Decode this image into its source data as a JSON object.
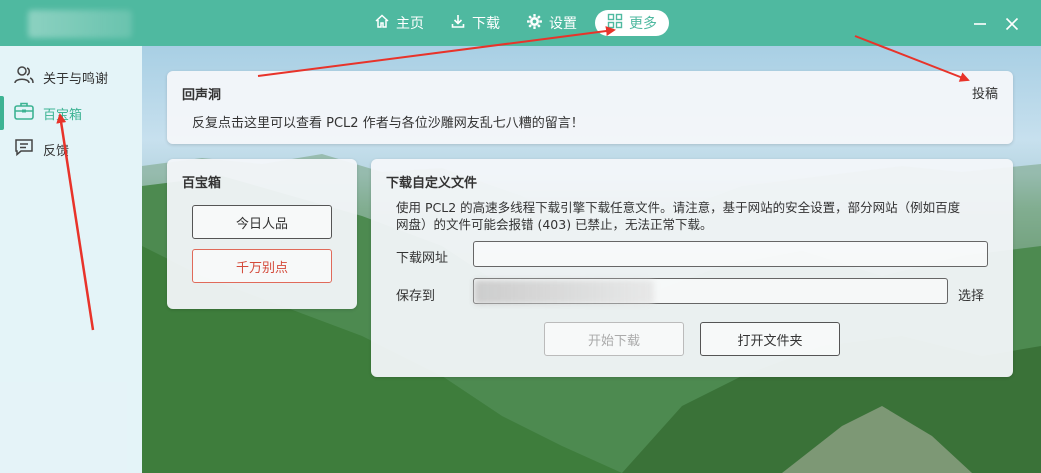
{
  "nav": {
    "items": [
      {
        "label": "主页",
        "icon": "home-icon"
      },
      {
        "label": "下载",
        "icon": "download-icon"
      },
      {
        "label": "设置",
        "icon": "gear-icon"
      },
      {
        "label": "更多",
        "icon": "grid-icon",
        "active": true
      }
    ],
    "minimize": "—",
    "close": "✕"
  },
  "sidebar": {
    "items": [
      {
        "label": "关于与鸣谢",
        "icon": "user-icon"
      },
      {
        "label": "百宝箱",
        "icon": "toolbox-icon",
        "active": true
      },
      {
        "label": "反馈",
        "icon": "chat-icon"
      }
    ]
  },
  "echo_card": {
    "title": "回声洞",
    "submit": "投稿",
    "text": "反复点击这里可以查看 PCL2 作者与各位沙雕网友乱七八糟的留言！"
  },
  "toolbox_card": {
    "title": "百宝箱",
    "btn_luck": "今日人品",
    "btn_noclick": "千万别点"
  },
  "download_card": {
    "title": "下载自定义文件",
    "desc_line1": "使用 PCL2 的高速多线程下载引擎下载任意文件。请注意，基于网站的安全设置，部分网站（例如百度",
    "desc_line2": "网盘）的文件可能会报错 (403) 已禁止，无法正常下载。",
    "url_label": "下载网址",
    "url_value": "",
    "save_label": "保存到",
    "choose": "选择",
    "start": "开始下载",
    "open_folder": "打开文件夹"
  },
  "colors": {
    "accent": "#4fb9a0",
    "annotation": "#e8332a"
  }
}
